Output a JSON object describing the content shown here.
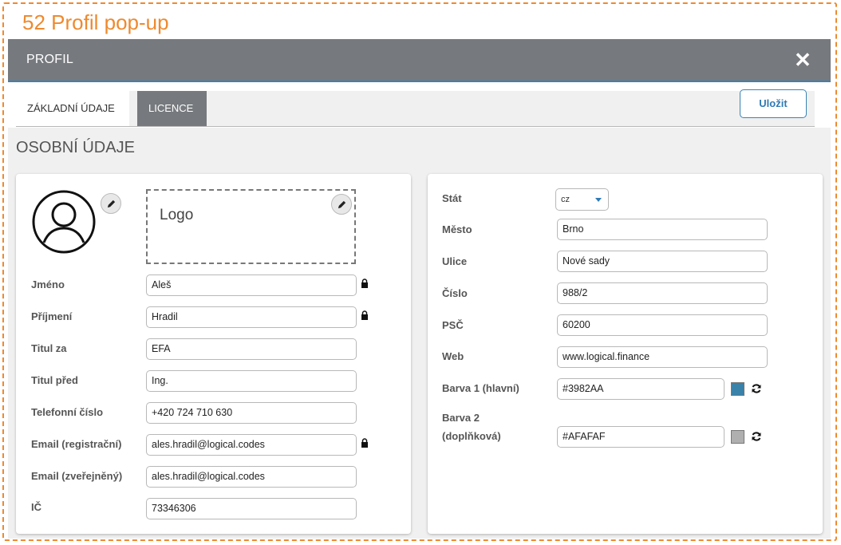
{
  "annotation": "52 Profil pop-up",
  "modal": {
    "title": "PROFIL",
    "close_symbol": "✕",
    "tabs": [
      {
        "label": "ZÁKLADNÍ ÚDAJE",
        "active": true
      },
      {
        "label": "LICENCE",
        "active": false
      }
    ],
    "save_label": "Uložit"
  },
  "section_title": "OSOBNÍ ÚDAJE",
  "left": {
    "logo_label": "Logo",
    "fields": [
      {
        "label": "Jméno",
        "value": "Aleš",
        "locked": true
      },
      {
        "label": "Příjmení",
        "value": "Hradil",
        "locked": true
      },
      {
        "label": "Titul za",
        "value": "EFA",
        "locked": false
      },
      {
        "label": "Titul před",
        "value": "Ing.",
        "locked": false
      },
      {
        "label": "Telefonní číslo",
        "value": "+420 724 710 630",
        "locked": false
      },
      {
        "label": "Email (registrační)",
        "value": "ales.hradil@logical.codes",
        "locked": true
      },
      {
        "label": "Email (zveřejněný)",
        "value": "ales.hradil@logical.codes",
        "locked": false
      },
      {
        "label": "IČ",
        "value": "73346306",
        "locked": false
      }
    ]
  },
  "right": {
    "country_label": "Stát",
    "country_value": "cz",
    "fields": [
      {
        "label": "Město",
        "value": "Brno"
      },
      {
        "label": "Ulice",
        "value": "Nové sady"
      },
      {
        "label": "Číslo",
        "value": "988/2"
      },
      {
        "label": "PSČ",
        "value": "60200"
      },
      {
        "label": "Web",
        "value": "www.logical.finance"
      }
    ],
    "color1_label": "Barva 1 (hlavní)",
    "color1_value": "#3982AA",
    "color2_label_line1": "Barva 2",
    "color2_label_line2": "(doplňková)",
    "color2_value": "#AFAFAF"
  },
  "colors": {
    "accent": "#ee8a2f",
    "header": "#76797d",
    "primary": "#3982AA",
    "secondary": "#AFAFAF"
  },
  "icons": {
    "avatar": "user-avatar-icon",
    "edit": "pencil-icon",
    "lock": "lock-icon",
    "refresh": "refresh-icon",
    "close": "close-icon",
    "dropdown": "chevron-down-icon"
  }
}
